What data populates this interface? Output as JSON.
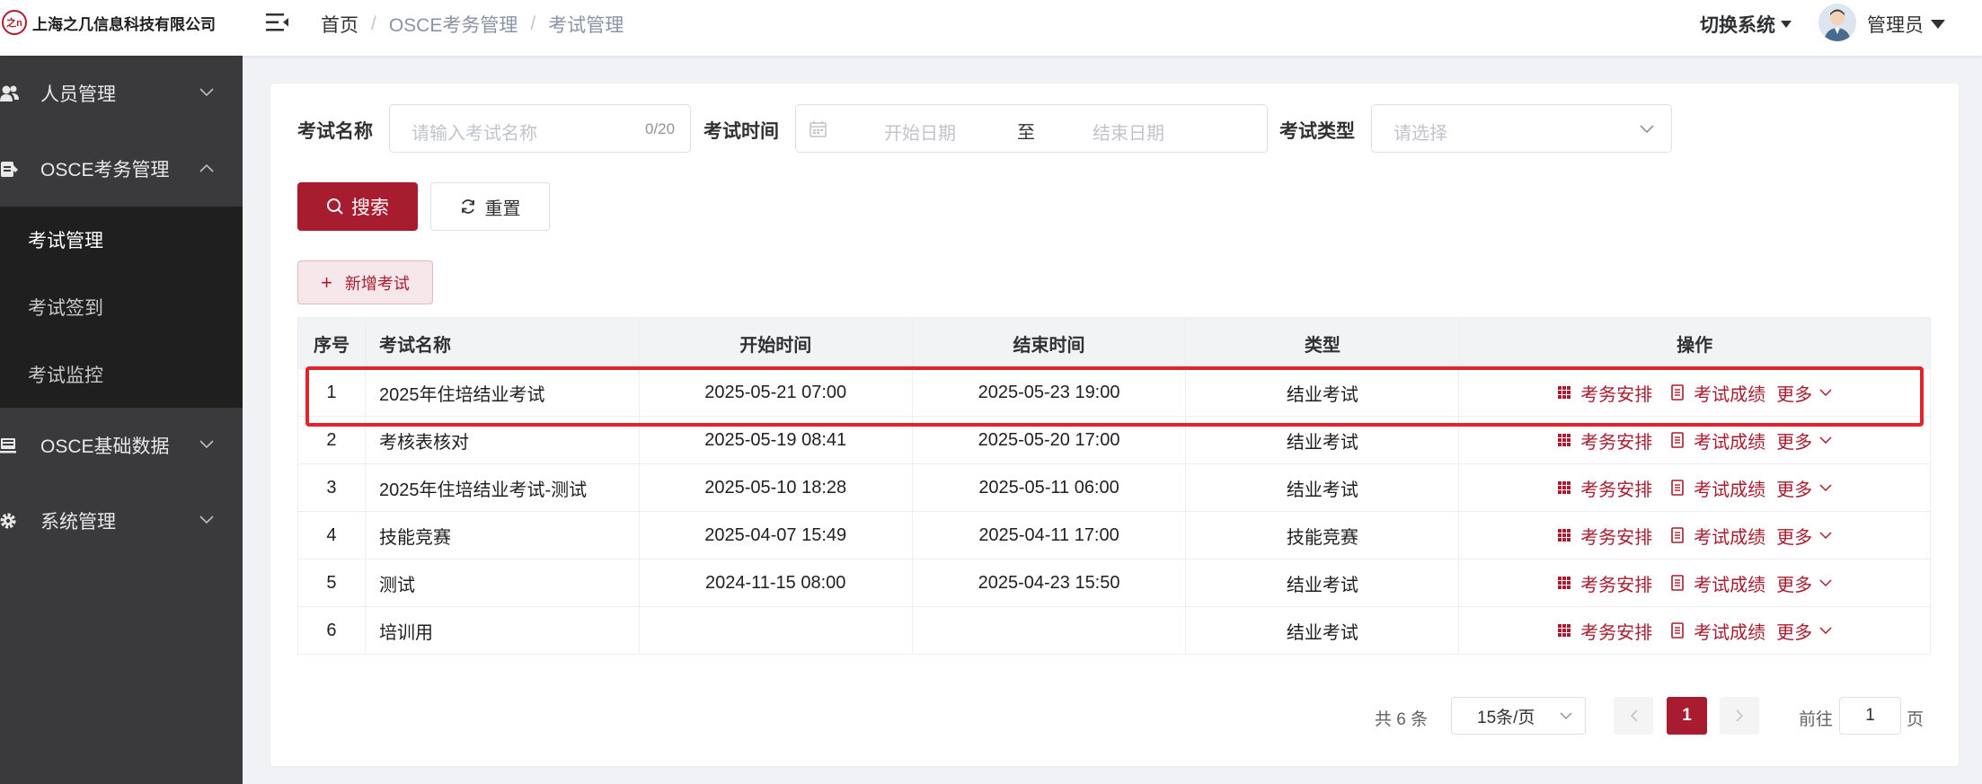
{
  "header": {
    "company": "上海之几信息科技有限公司",
    "logo_mark": "之n",
    "breadcrumb": [
      "首页",
      "OSCE考务管理",
      "考试管理"
    ],
    "switch_system": "切换系统",
    "user": "管理员"
  },
  "sidebar": {
    "items": [
      {
        "label": "人员管理",
        "icon": "users-icon"
      },
      {
        "label": "OSCE考务管理",
        "icon": "clipboard-icon"
      },
      {
        "label": "OSCE基础数据",
        "icon": "monitor-icon"
      },
      {
        "label": "系统管理",
        "icon": "gear-icon"
      }
    ],
    "submenu": [
      "考试管理",
      "考试签到",
      "考试监控"
    ]
  },
  "filters": {
    "name_label": "考试名称",
    "name_placeholder": "请输入考试名称",
    "name_counter": "0/20",
    "time_label": "考试时间",
    "start_placeholder": "开始日期",
    "range_sep": "至",
    "end_placeholder": "结束日期",
    "type_label": "考试类型",
    "type_placeholder": "请选择"
  },
  "buttons": {
    "search": "搜索",
    "reset": "重置",
    "add": "新增考试"
  },
  "table": {
    "headers": [
      "序号",
      "考试名称",
      "开始时间",
      "结束时间",
      "类型",
      "操作"
    ],
    "rows": [
      {
        "no": "1",
        "name": "2025年住培结业考试",
        "start": "2025-05-21 07:00",
        "end": "2025-05-23 19:00",
        "type": "结业考试"
      },
      {
        "no": "2",
        "name": "考核表核对",
        "start": "2025-05-19 08:41",
        "end": "2025-05-20 17:00",
        "type": "结业考试"
      },
      {
        "no": "3",
        "name": "2025年住培结业考试-测试",
        "start": "2025-05-10 18:28",
        "end": "2025-05-11 06:00",
        "type": "结业考试"
      },
      {
        "no": "4",
        "name": "技能竞赛",
        "start": "2025-04-07 15:49",
        "end": "2025-04-11 17:00",
        "type": "技能竞赛"
      },
      {
        "no": "5",
        "name": "测试",
        "start": "2024-11-15 08:00",
        "end": "2025-04-23 15:50",
        "type": "结业考试"
      },
      {
        "no": "6",
        "name": "培训用",
        "start": "",
        "end": "",
        "type": "结业考试"
      }
    ],
    "ops": {
      "arrange": "考务安排",
      "score": "考试成绩",
      "more": "更多"
    }
  },
  "pagination": {
    "total": "共 6 条",
    "page_size": "15条/页",
    "current": "1",
    "goto": "前往",
    "goto_value": "1",
    "page_unit": "页"
  },
  "colors": {
    "primary": "#a81c2f",
    "sidebar_bg": "#3a3a3c",
    "submenu_bg": "#1f1f1f",
    "highlight": "#e0242a"
  }
}
